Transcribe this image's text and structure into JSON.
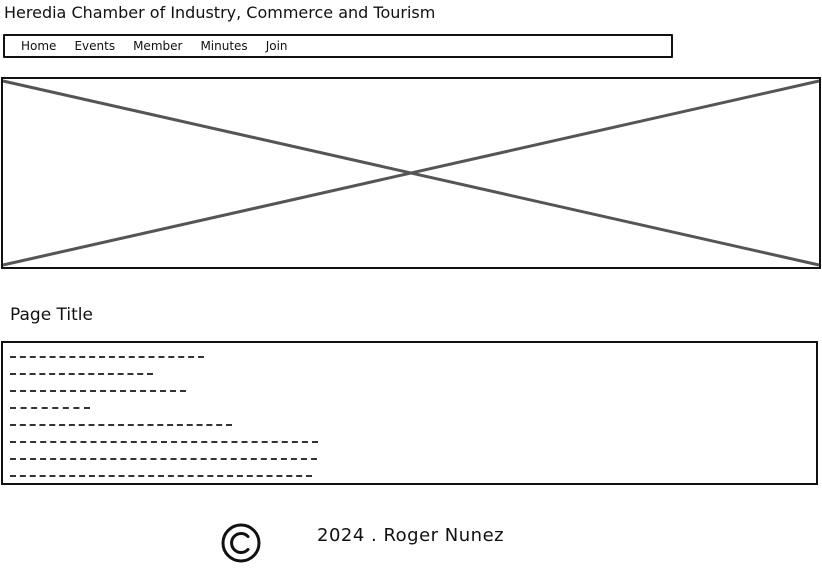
{
  "header": {
    "site_title": "Heredia Chamber of Industry, Commerce and Tourism"
  },
  "nav": {
    "items": [
      {
        "label": "Home"
      },
      {
        "label": "Events"
      },
      {
        "label": "Member"
      },
      {
        "label": "Minutes"
      },
      {
        "label": "Join"
      }
    ]
  },
  "hero": {
    "icon": "image-placeholder-icon"
  },
  "main": {
    "page_title": "Page Title",
    "placeholder_line_count": 8
  },
  "footer": {
    "icon": "copyright-icon",
    "text": "2024 . Roger Nunez"
  }
}
